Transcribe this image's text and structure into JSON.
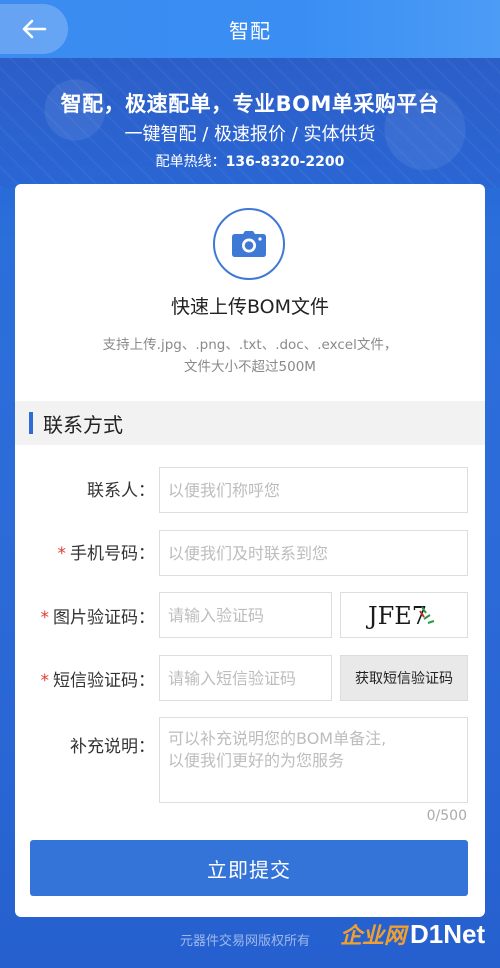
{
  "header": {
    "title": "智配",
    "back_icon": "arrow-left-icon"
  },
  "banner": {
    "slogan": "智配，极速配单，专业BOM单采购平台",
    "subslogan": "一键智配 / 极速报价 / 实体供货",
    "hotline_label": "配单热线：",
    "hotline_number": "136-8320-2200"
  },
  "upload": {
    "icon": "camera-icon",
    "title": "快速上传BOM文件",
    "hint_line1": "支持上传.jpg、.png、.txt、.doc、.excel文件，",
    "hint_line2": "文件大小不超过500M"
  },
  "contact": {
    "section_title": "联系方式",
    "name_label": "联系人：",
    "name_placeholder": "以便我们称呼您",
    "phone_required": "*",
    "phone_label": "手机号码：",
    "phone_placeholder": "以便我们及时联系到您",
    "captcha_required": "*",
    "captcha_label": "图片验证码：",
    "captcha_placeholder": "请输入验证码",
    "captcha_text": "JFE7",
    "sms_required": "*",
    "sms_label": "短信验证码：",
    "sms_placeholder": "请输入短信验证码",
    "sms_button": "获取短信验证码",
    "note_label": "补充说明：",
    "note_placeholder": "可以补充说明您的BOM单备注,\n以便我们更好的为您服务",
    "note_counter": "0/500",
    "submit": "立即提交"
  },
  "footer": {
    "copyright": "元器件交易网版权所有",
    "watermark_a": "企业网",
    "watermark_b": "D1Net"
  },
  "colors": {
    "primary": "#3474d9",
    "required": "#e53935"
  }
}
